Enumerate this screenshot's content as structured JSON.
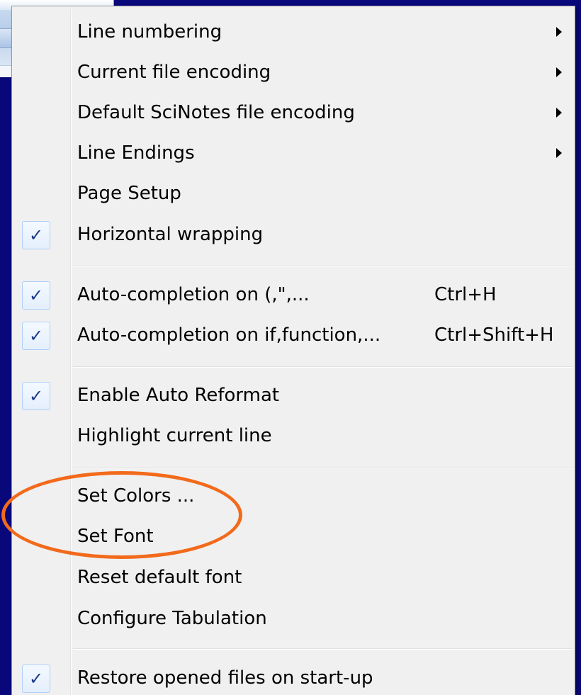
{
  "menu": {
    "items": [
      {
        "label": "Line numbering",
        "checked": false,
        "submenu": true,
        "shortcut": ""
      },
      {
        "label": "Current file encoding",
        "checked": false,
        "submenu": true,
        "shortcut": ""
      },
      {
        "label": "Default SciNotes file encoding",
        "checked": false,
        "submenu": true,
        "shortcut": ""
      },
      {
        "label": "Line Endings",
        "checked": false,
        "submenu": true,
        "shortcut": ""
      },
      {
        "label": "Page Setup",
        "checked": false,
        "submenu": false,
        "shortcut": ""
      },
      {
        "label": "Horizontal wrapping",
        "checked": true,
        "submenu": false,
        "shortcut": ""
      },
      {
        "label": "Auto-completion on (,\",...",
        "checked": true,
        "submenu": false,
        "shortcut": "Ctrl+H"
      },
      {
        "label": "Auto-completion on if,function,...",
        "checked": true,
        "submenu": false,
        "shortcut": "Ctrl+Shift+H"
      },
      {
        "label": "Enable Auto Reformat",
        "checked": true,
        "submenu": false,
        "shortcut": ""
      },
      {
        "label": "Highlight current line",
        "checked": false,
        "submenu": false,
        "shortcut": ""
      },
      {
        "label": "Set Colors ...",
        "checked": false,
        "submenu": false,
        "shortcut": ""
      },
      {
        "label": "Set Font",
        "checked": false,
        "submenu": false,
        "shortcut": ""
      },
      {
        "label": "Reset default font",
        "checked": false,
        "submenu": false,
        "shortcut": ""
      },
      {
        "label": "Configure Tabulation",
        "checked": false,
        "submenu": false,
        "shortcut": ""
      },
      {
        "label": "Restore opened files on start-up",
        "checked": true,
        "submenu": false,
        "shortcut": ""
      }
    ],
    "check_glyph": "✓"
  },
  "colors": {
    "desktop": "#08087a",
    "menu_background": "#f0f0f0",
    "annotation": "#f26a1b",
    "check": "#1a3a86"
  }
}
